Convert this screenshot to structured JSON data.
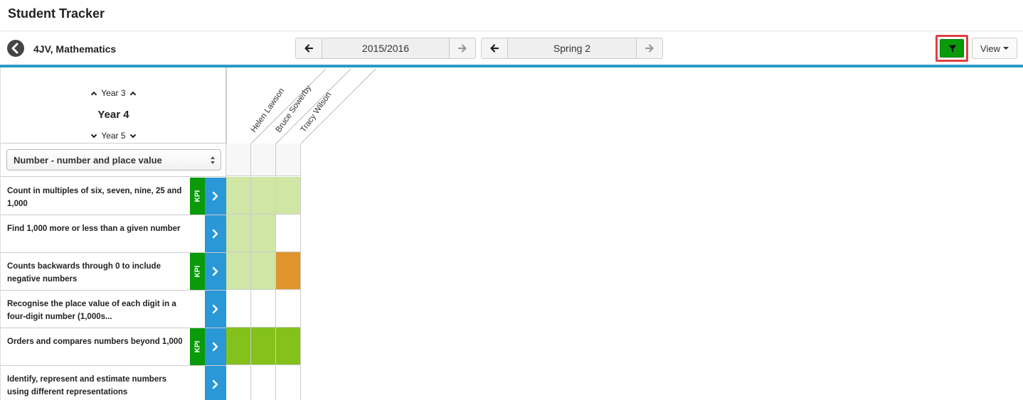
{
  "app": {
    "title": "Student Tracker"
  },
  "toolbar": {
    "class_name": "4JV, Mathematics",
    "year_label": "2015/2016",
    "term_label": "Spring 2",
    "view_label": "View"
  },
  "colors": {
    "accent": "#2a9bc4",
    "kpi": "#0a9a0a",
    "go": "#2a97d6",
    "light_green": "#cfe6a5",
    "green": "#84c11b",
    "orange": "#e0952e",
    "empty": "#ffffff"
  },
  "year_nav": {
    "prev": "Year 3",
    "current": "Year 4",
    "next": "Year 5"
  },
  "strand": {
    "selected": "Number - number and place value"
  },
  "students": [
    "Helen Lawson",
    "Bruce Sowerby",
    "Tracy Wilson"
  ],
  "objectives": [
    {
      "text": "Count in multiples of six, seven, nine, 25 and 1,000",
      "kpi": true,
      "kpi_label": "KPI",
      "cells": [
        "light_green",
        "light_green",
        "light_green"
      ]
    },
    {
      "text": "Find 1,000 more or less than a given number",
      "kpi": false,
      "kpi_label": "",
      "cells": [
        "light_green",
        "light_green",
        "empty"
      ]
    },
    {
      "text": "Counts backwards through 0 to include negative numbers",
      "kpi": true,
      "kpi_label": "KPI",
      "cells": [
        "light_green",
        "light_green",
        "orange"
      ]
    },
    {
      "text": "Recognise the place value of each digit in a four-digit number (1,000s...",
      "kpi": false,
      "kpi_label": "",
      "cells": [
        "empty",
        "empty",
        "empty"
      ]
    },
    {
      "text": "Orders and compares numbers beyond 1,000",
      "kpi": true,
      "kpi_label": "KPI",
      "cells": [
        "green",
        "green",
        "green"
      ]
    },
    {
      "text": "Identify, represent and estimate numbers using different representations",
      "kpi": false,
      "kpi_label": "",
      "cells": [
        "empty",
        "empty",
        "empty"
      ]
    }
  ]
}
